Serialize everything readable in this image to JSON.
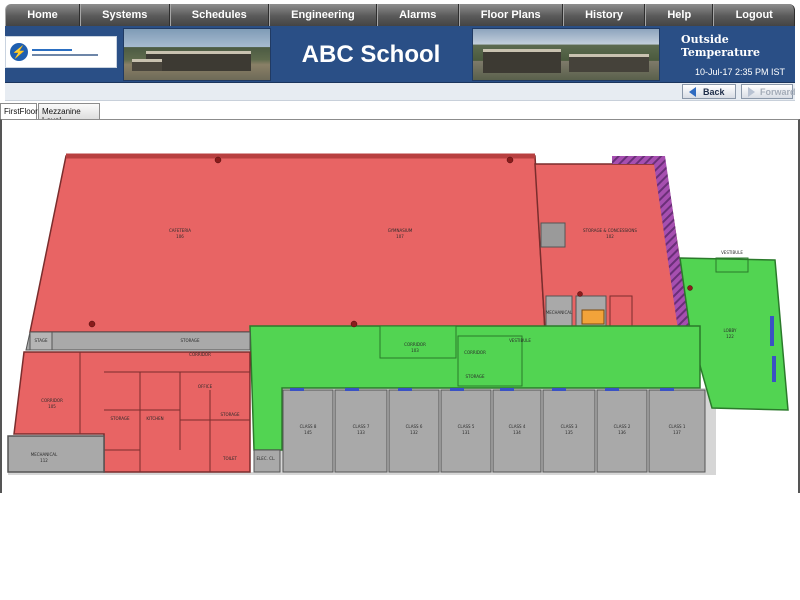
{
  "menu": {
    "items": [
      "Home",
      "Systems",
      "Schedules",
      "Engineering",
      "Alarms",
      "Floor Plans",
      "History",
      "Help",
      "Logout"
    ]
  },
  "banner": {
    "title": "ABC School",
    "outside_temp_label": "Outside Temperature",
    "timestamp": "10-Jul-17 2:35 PM IST"
  },
  "nav": {
    "back_label": "Back",
    "forward_label": "Forward"
  },
  "tabs": {
    "items": [
      "FirstFloor",
      "Mezzanine Level"
    ],
    "active": "FirstFloor"
  },
  "colors": {
    "hot_zone": "#e86464",
    "normal_zone": "#52d452",
    "unconditioned": "#a9a9a9",
    "header_blue": "#2a4f86"
  },
  "floorplan": {
    "rooms": [
      {
        "name": "CAFETERIA",
        "sub": "106"
      },
      {
        "name": "GYMNASIUM",
        "sub": "107"
      },
      {
        "name": "STORAGE & CONCESSIONS",
        "sub": "102"
      },
      {
        "name": "LOBBY",
        "sub": "122"
      },
      {
        "name": "VESTIBULE",
        "sub": "101A"
      },
      {
        "name": "CORRIDOR",
        "sub": "103"
      },
      {
        "name": "VESTIBULE",
        "sub": "104"
      },
      {
        "name": "CORRIDOR",
        "sub": "124"
      },
      {
        "name": "STORAGE",
        "sub": "109"
      },
      {
        "name": "MECHANICAL",
        "sub": "112"
      },
      {
        "name": "STAGE",
        "sub": "113"
      },
      {
        "name": "STORAGE",
        "sub": "111"
      },
      {
        "name": "CORRIDOR",
        "sub": "105"
      },
      {
        "name": "STORAGE",
        "sub": "118"
      },
      {
        "name": "KITCHEN",
        "sub": "108"
      },
      {
        "name": "OFFICE",
        "sub": "109"
      },
      {
        "name": "STORAGE",
        "sub": "120"
      },
      {
        "name": "TOILET",
        "sub": "121"
      },
      {
        "name": "CORRIDOR",
        "sub": "100"
      },
      {
        "name": "MECHANICAL",
        "sub": "141"
      },
      {
        "name": "ELEC. CL.",
        "sub": "142"
      },
      {
        "name": "CLASS 8",
        "sub": "145"
      },
      {
        "name": "CLASS 7",
        "sub": "133"
      },
      {
        "name": "CLASS 6",
        "sub": "132"
      },
      {
        "name": "CLASS 5",
        "sub": "131"
      },
      {
        "name": "CLASS 4",
        "sub": "134"
      },
      {
        "name": "CLASS 3",
        "sub": "135"
      },
      {
        "name": "CLASS 2",
        "sub": "136"
      },
      {
        "name": "CLASS 1",
        "sub": "137"
      }
    ]
  }
}
